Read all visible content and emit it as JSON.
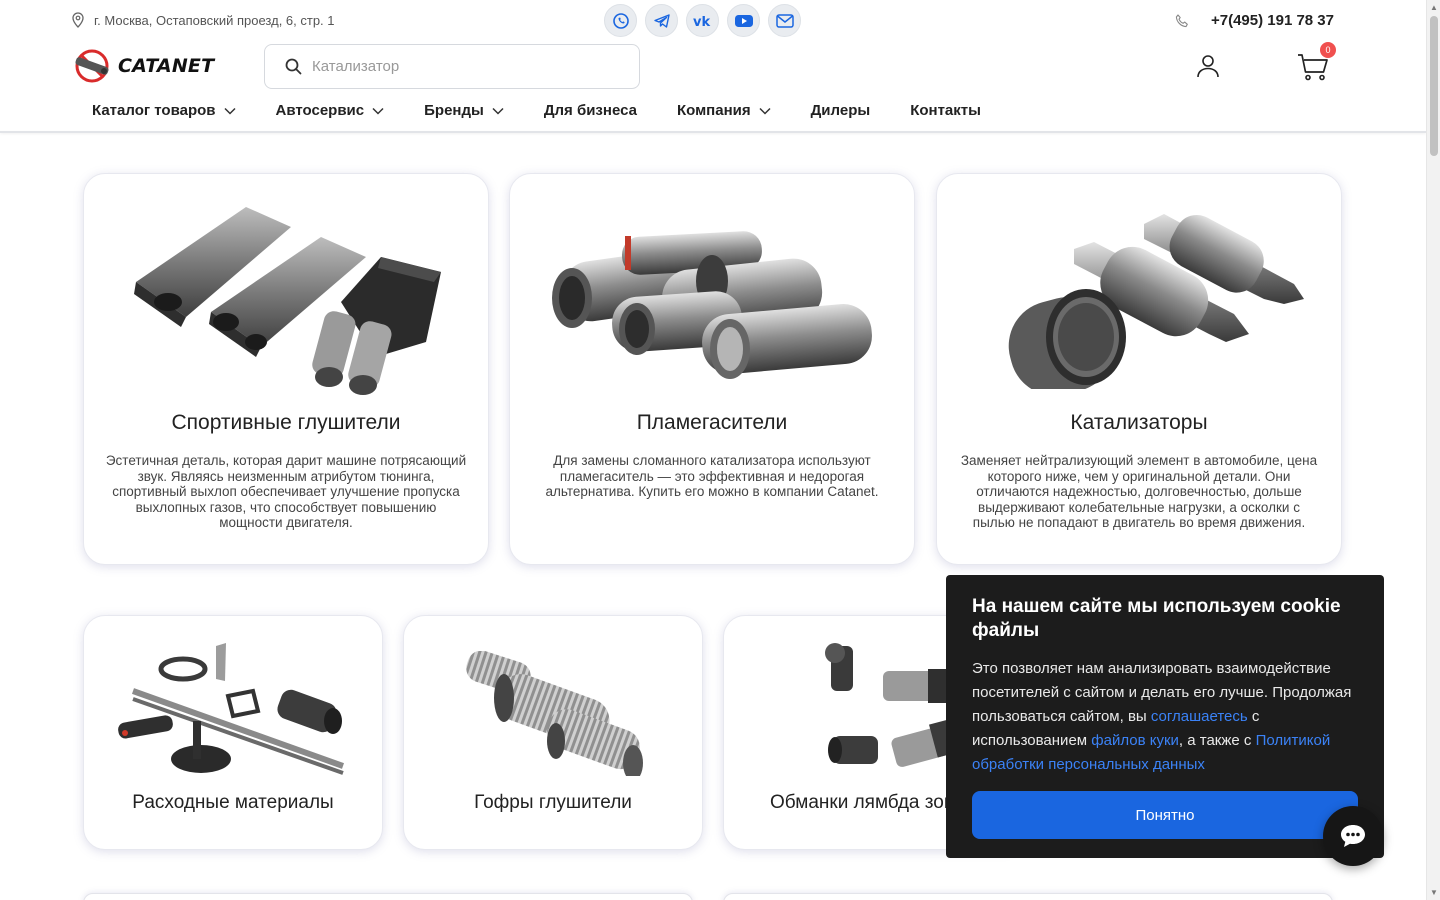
{
  "topbar": {
    "address": "г. Москва, Остаповский проезд, 6, стр. 1",
    "socials": [
      "whatsapp-icon",
      "telegram-icon",
      "vk-icon",
      "youtube-icon",
      "mail-icon"
    ],
    "phone": "+7(495) 191 78 37"
  },
  "header": {
    "logo_text": "CATANET",
    "search_placeholder": "Катализатор",
    "cart_count": "0"
  },
  "nav": {
    "items": [
      {
        "label": "Каталог товаров",
        "dropdown": true
      },
      {
        "label": "Автосервис",
        "dropdown": true
      },
      {
        "label": "Бренды",
        "dropdown": true
      },
      {
        "label": "Для бизнеса",
        "dropdown": false
      },
      {
        "label": "Компания",
        "dropdown": true
      },
      {
        "label": "Дилеры",
        "dropdown": false
      },
      {
        "label": "Контакты",
        "dropdown": false
      }
    ]
  },
  "categories_main": [
    {
      "title": "Спортивные глушители",
      "description": "Эстетичная деталь, которая дарит машине потрясающий звук. Являясь неизменным атрибутом тюнинга, спортивный выхлоп обеспечивает улучшение пропуска выхлопных газов, что способствует повышению мощности двигателя."
    },
    {
      "title": "Пламегасители",
      "description": "Для замены сломанного катализатора используют пламегаситель — это эффективная и недорогая альтернатива. Купить его можно в компании Catanet."
    },
    {
      "title": "Катализаторы",
      "description": "Заменяет нейтрализующий элемент в автомобиле, цена которого ниже, чем у оригинальной детали. Они отличаются надежностью, долговечностью, дольше выдерживают колебательные нагрузки, а осколки с пылью не попадают в двигатель во время движения."
    }
  ],
  "categories_secondary": [
    {
      "title": "Расходные материалы"
    },
    {
      "title": "Гофры глушители"
    },
    {
      "title": "Обманки лямбда зонда"
    }
  ],
  "cookie": {
    "title": "На нашем сайте мы используем cookie файлы",
    "text_1": "Это позволяет нам анализировать взаимодействие посетителей с сайтом и делать его лучше. Продолжая пользоваться сайтом, вы ",
    "link_agree": "соглашаетесь",
    "text_2": " с использованием ",
    "link_cookies": "файлов куки",
    "text_3": ", а также с ",
    "link_policy": "Политикой обработки персональных данных",
    "button": "Понятно"
  },
  "colors": {
    "accent": "#1a66e0",
    "link": "#3b82f6",
    "badge": "#f0504f",
    "cookie_bg": "#1c1c1c"
  }
}
